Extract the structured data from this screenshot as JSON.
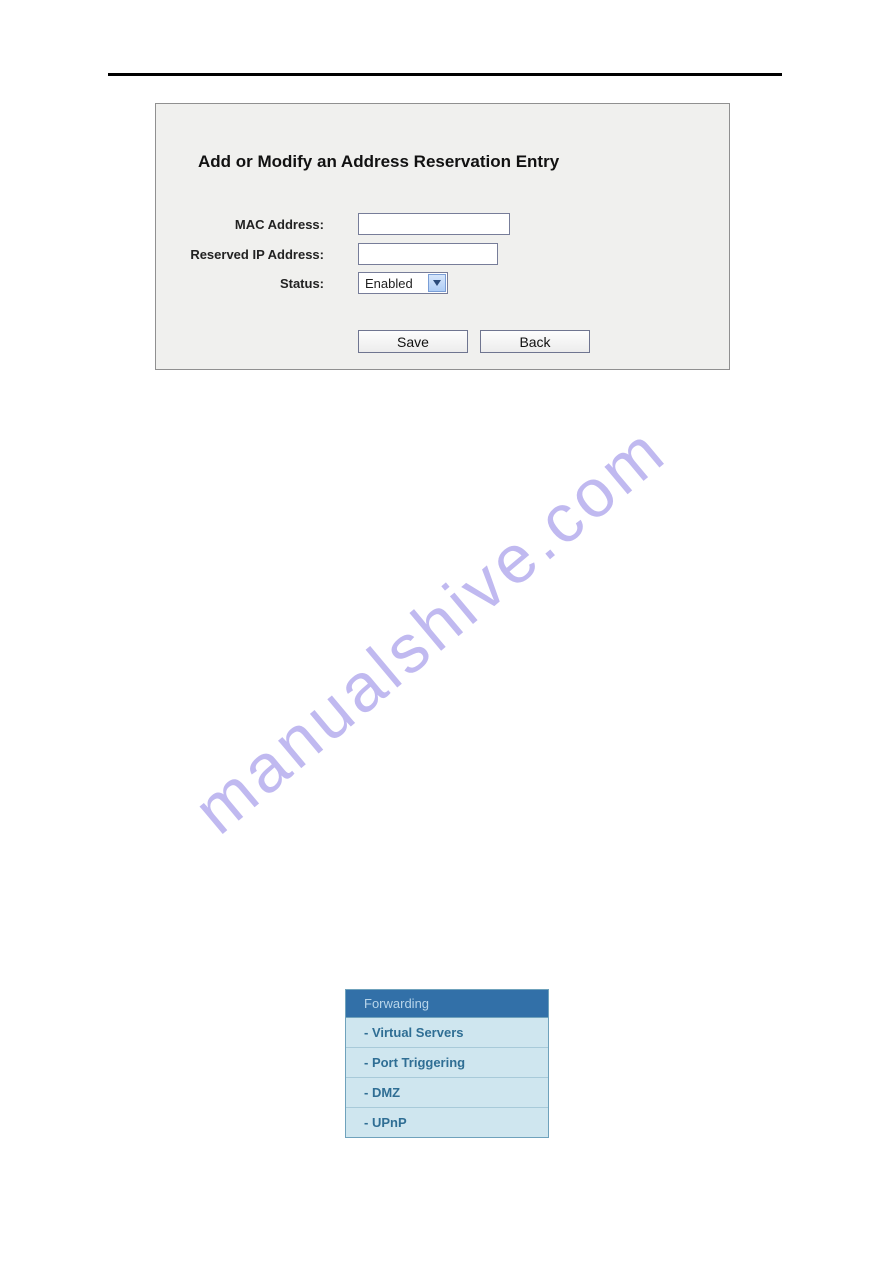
{
  "form": {
    "title": "Add or Modify an Address Reservation Entry",
    "mac_label": "MAC Address:",
    "mac_value": "",
    "ip_label": "Reserved IP Address:",
    "ip_value": "",
    "status_label": "Status:",
    "status_value": "Enabled",
    "save_label": "Save",
    "back_label": "Back"
  },
  "watermark": "manualshive.com",
  "nav": {
    "header": "Forwarding",
    "items": [
      "- Virtual Servers",
      "- Port Triggering",
      "- DMZ",
      "- UPnP"
    ]
  }
}
